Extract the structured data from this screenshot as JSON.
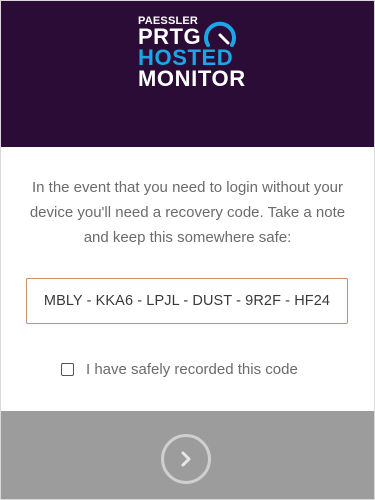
{
  "logo": {
    "line1": "PAESSLER",
    "line2": "PRTG",
    "line3": "HOSTED",
    "line4": "MONITOR",
    "brand_blue": "#1aa6e8",
    "header_bg": "#2a0c36"
  },
  "recovery": {
    "instructions": "In the event that you need to login without your device you'll need a recovery code. Take a note and keep this somewhere safe:",
    "code": "MBLY - KKA6 - LPJL - DUST - 9R2F - HF24",
    "confirm_label": "I have safely recorded this code",
    "confirm_checked": false
  },
  "footer": {
    "next_icon": "chevron-right-icon",
    "bg": "#9c9c9c"
  }
}
